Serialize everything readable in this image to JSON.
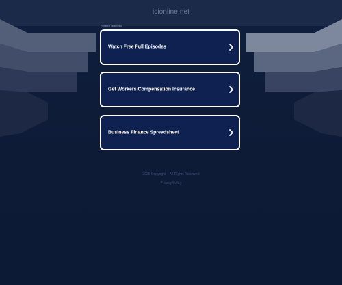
{
  "header": {
    "domain": "icionline.net"
  },
  "sponsored_label": "Related searches",
  "listings": [
    {
      "label": "Watch Free Full Episodes",
      "icon": "chevron-right-icon"
    },
    {
      "label": "Get Workers Compensation Insurance",
      "icon": "chevron-right-icon"
    },
    {
      "label": "Business Finance Spreadsheet",
      "icon": "chevron-right-icon"
    }
  ],
  "footer": {
    "links": [
      "2025 Copyright",
      "All Rights Reserved"
    ],
    "privacy": "Privacy Policy"
  },
  "colors": {
    "background": "#0d1b38",
    "topbar": "#1a2a48",
    "listing_bg": "#0e2150",
    "listing_border": "#ffffff"
  }
}
